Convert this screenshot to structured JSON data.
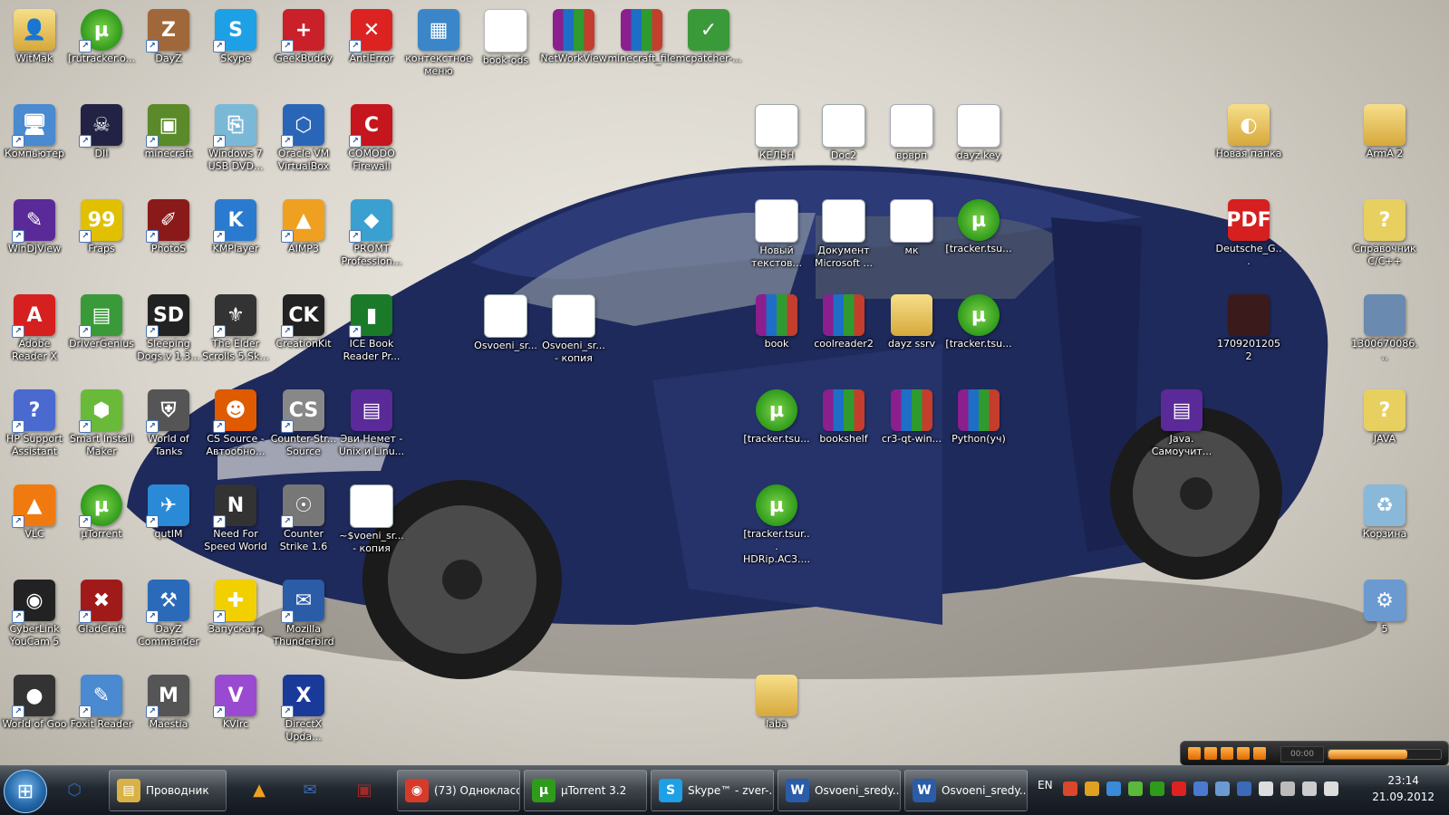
{
  "desktop": {
    "icons": [
      {
        "label": "WitMak",
        "icon": "folder-user-icon",
        "glyph": "👤",
        "color": "#d8b247"
      },
      {
        "label": "[rutracker.o...",
        "icon": "utorrent-icon",
        "glyph": "µ",
        "color": "#2f9b1b"
      },
      {
        "label": "DayZ",
        "icon": "dayz-icon",
        "glyph": "Z",
        "color": "#a0683a"
      },
      {
        "label": "Skype",
        "icon": "skype-icon",
        "glyph": "S",
        "color": "#1ea0e6"
      },
      {
        "label": "GeekBuddy",
        "icon": "geekbuddy-icon",
        "glyph": "+",
        "color": "#c9202a"
      },
      {
        "label": "AntiError",
        "icon": "antierror-shield-icon",
        "glyph": "✕",
        "color": "#d22"
      },
      {
        "label": "контекстное\nменю",
        "icon": "context-menu-icon",
        "glyph": "▦",
        "color": "#3a86c8"
      },
      {
        "label": "book-ods",
        "icon": "pdf-file-icon",
        "glyph": "",
        "color": "#ffffff"
      },
      {
        "label": "NetWorkView",
        "icon": "winrar-icon",
        "glyph": "",
        "color": "#8b1f8e"
      },
      {
        "label": "minecraft_file",
        "icon": "winrar-icon",
        "glyph": "",
        "color": "#8b1f8e"
      },
      {
        "label": "mcpatcher-...",
        "icon": "mcpatcher-icon",
        "glyph": "✓",
        "color": "#3a9a3a"
      },
      {
        "label": "Компьютер",
        "icon": "computer-icon",
        "glyph": "🖥",
        "color": "#4a8ad0"
      },
      {
        "label": "DII",
        "icon": "diablo-icon",
        "glyph": "☠",
        "color": "#222244"
      },
      {
        "label": "minecraft",
        "icon": "minecraft-icon",
        "glyph": "▣",
        "color": "#5a8a2a"
      },
      {
        "label": "Windows 7\nUSB DVD...",
        "icon": "usb-dvd-tool-icon",
        "glyph": "⎘",
        "color": "#7ab8d8"
      },
      {
        "label": "Oracle VM\nVirtualBox",
        "icon": "virtualbox-icon",
        "glyph": "⬡",
        "color": "#2a66b8"
      },
      {
        "label": "COMODO\nFirewall",
        "icon": "comodo-icon",
        "glyph": "C",
        "color": "#c4161c"
      },
      {
        "label": "WinDjView",
        "icon": "windjview-icon",
        "glyph": "✎",
        "color": "#5a2a98"
      },
      {
        "label": "Fraps",
        "icon": "fraps-icon",
        "glyph": "99",
        "color": "#e0c000"
      },
      {
        "label": "PhotoS",
        "icon": "photoshop-brush-icon",
        "glyph": "✐",
        "color": "#8a1a1a"
      },
      {
        "label": "KMPlayer",
        "icon": "kmplayer-icon",
        "glyph": "K",
        "color": "#2a7ad0"
      },
      {
        "label": "AIMP3",
        "icon": "aimp-icon",
        "glyph": "▲",
        "color": "#f0a020"
      },
      {
        "label": "PROMT\nProfession...",
        "icon": "promt-icon",
        "glyph": "◆",
        "color": "#3aa0d0"
      },
      {
        "label": "Adobe\nReader X",
        "icon": "adobe-reader-icon",
        "glyph": "A",
        "color": "#d61f1f"
      },
      {
        "label": "DriverGenius",
        "icon": "drivergenius-icon",
        "glyph": "▤",
        "color": "#3a9a3a"
      },
      {
        "label": "Sleeping\nDogs.v 1.3...",
        "icon": "sleeping-dogs-icon",
        "glyph": "SD",
        "color": "#222"
      },
      {
        "label": "The Elder\nScrolls 5.Sk...",
        "icon": "skyrim-icon",
        "glyph": "⚜",
        "color": "#333"
      },
      {
        "label": "CreationKit",
        "icon": "creationkit-icon",
        "glyph": "CK",
        "color": "#222"
      },
      {
        "label": "ICE Book\nReader Pr...",
        "icon": "ice-book-icon",
        "glyph": "▮",
        "color": "#1a7a2a"
      },
      {
        "label": "HP Support\nAssistant",
        "icon": "hp-support-icon",
        "glyph": "?",
        "color": "#4a6ad0"
      },
      {
        "label": "Smart Install\nMaker",
        "icon": "smart-install-icon",
        "glyph": "⬢",
        "color": "#6aba3a"
      },
      {
        "label": "World of\nTanks",
        "icon": "world-of-tanks-icon",
        "glyph": "⛨",
        "color": "#555"
      },
      {
        "label": "CS Source -\nАвтообно...",
        "icon": "cs-source-update-icon",
        "glyph": "☻",
        "color": "#e05a00"
      },
      {
        "label": "Counter-Str...\nSource",
        "icon": "counter-strike-source-icon",
        "glyph": "CS",
        "color": "#888"
      },
      {
        "label": "Эви Немет -\nUnix и Linu...",
        "icon": "djvu-file-icon",
        "glyph": "▤",
        "color": "#5a2a98"
      },
      {
        "label": "VLC",
        "icon": "vlc-icon",
        "glyph": "▲",
        "color": "#f07a10"
      },
      {
        "label": "µTorrent",
        "icon": "utorrent-icon",
        "glyph": "µ",
        "color": "#2f9b1b"
      },
      {
        "label": "qutIM",
        "icon": "qutim-icon",
        "glyph": "✈",
        "color": "#2a8ad8"
      },
      {
        "label": "Need For\nSpeed World",
        "icon": "nfs-world-icon",
        "glyph": "N",
        "color": "#333"
      },
      {
        "label": "Counter\nStrike 1.6",
        "icon": "counter-strike-icon",
        "glyph": "☉",
        "color": "#777"
      },
      {
        "label": "~$voeni_sr...\n- копия",
        "icon": "word-doc-icon",
        "glyph": "W",
        "color": "#2a5ca8"
      },
      {
        "label": "CyberLink\nYouCam 5",
        "icon": "youcam-icon",
        "glyph": "◉",
        "color": "#222"
      },
      {
        "label": "GladCraft",
        "icon": "gladcraft-icon",
        "glyph": "✖",
        "color": "#a01a1a"
      },
      {
        "label": "DayZ\nCommander",
        "icon": "dayz-commander-icon",
        "glyph": "⚒",
        "color": "#2a6ab8"
      },
      {
        "label": "Запускатр",
        "icon": "launcher-icon",
        "glyph": "✚",
        "color": "#f2d000"
      },
      {
        "label": "Mozilla\nThunderbird",
        "icon": "thunderbird-icon",
        "glyph": "✉",
        "color": "#2a5ca8"
      },
      {
        "label": "World of Goo",
        "icon": "world-of-goo-icon",
        "glyph": "●",
        "color": "#333"
      },
      {
        "label": "Foxit Reader",
        "icon": "foxit-reader-icon",
        "glyph": "✎",
        "color": "#4a8ad0"
      },
      {
        "label": "Maestia",
        "icon": "maestia-icon",
        "glyph": "M",
        "color": "#555"
      },
      {
        "label": "KVIrc",
        "icon": "kvirc-icon",
        "glyph": "V",
        "color": "#9a4ad0"
      },
      {
        "label": "DirectX\nUpda...",
        "icon": "directx-icon",
        "glyph": "X",
        "color": "#1a3a9a"
      },
      {
        "label": "КЕЛЬН",
        "icon": "word-doc-icon",
        "glyph": "W",
        "color": "#2a5ca8"
      },
      {
        "label": "Doc2",
        "icon": "word-doc-icon",
        "glyph": "W",
        "color": "#2a5ca8"
      },
      {
        "label": "врврп",
        "icon": "text-file-icon",
        "glyph": "",
        "color": "#fff"
      },
      {
        "label": "dayz.key",
        "icon": "text-file-icon",
        "glyph": "",
        "color": "#fff"
      },
      {
        "label": "Новый\nтекстов...",
        "icon": "text-file-icon",
        "glyph": "",
        "color": "#fff"
      },
      {
        "label": "Документ\nMicrosoft ...",
        "icon": "word-doc-icon",
        "glyph": "W",
        "color": "#2a5ca8"
      },
      {
        "label": "мк",
        "icon": "text-file-icon",
        "glyph": "",
        "color": "#fff"
      },
      {
        "label": "[tracker.tsu...",
        "icon": "utorrent-icon",
        "glyph": "µ",
        "color": "#2f9b1b"
      },
      {
        "label": "Osvoeni_sr...",
        "icon": "word-doc-icon",
        "glyph": "W",
        "color": "#2a5ca8"
      },
      {
        "label": "Osvoeni_sr...\n- копия",
        "icon": "word-doc-icon",
        "glyph": "W",
        "color": "#2a5ca8"
      },
      {
        "label": "book",
        "icon": "winrar-icon",
        "glyph": "",
        "color": "#8b1f8e"
      },
      {
        "label": "coolreader2",
        "icon": "winrar-icon",
        "glyph": "",
        "color": "#8b1f8e"
      },
      {
        "label": "dayz ssrv",
        "icon": "folder-icon",
        "glyph": "",
        "color": "#d8b247"
      },
      {
        "label": "[tracker.tsu...",
        "icon": "utorrent-icon",
        "glyph": "µ",
        "color": "#2f9b1b"
      },
      {
        "label": "[tracker.tsu...",
        "icon": "utorrent-icon",
        "glyph": "µ",
        "color": "#2f9b1b"
      },
      {
        "label": "bookshelf",
        "icon": "winrar-icon",
        "glyph": "",
        "color": "#8b1f8e"
      },
      {
        "label": "cr3-qt-win...",
        "icon": "winrar-icon",
        "glyph": "",
        "color": "#8b1f8e"
      },
      {
        "label": "Python(уч)",
        "icon": "winrar-icon",
        "glyph": "",
        "color": "#8b1f8e"
      },
      {
        "label": "[tracker.tsur...\nHDRip.AC3....",
        "icon": "utorrent-icon",
        "glyph": "µ",
        "color": "#2f9b1b"
      },
      {
        "label": "laba",
        "icon": "folder-icon",
        "glyph": "",
        "color": "#d8b247"
      },
      {
        "label": "Новая папка",
        "icon": "folder-icon",
        "glyph": "◐",
        "color": "#d8b247"
      },
      {
        "label": "Deutsche_G...",
        "icon": "pdf-file-icon",
        "glyph": "PDF",
        "color": "#d61f1f"
      },
      {
        "label": "17092012052",
        "icon": "image-file-icon",
        "glyph": "",
        "color": "#3a1a1a"
      },
      {
        "label": "Java.\nСамоучит...",
        "icon": "djvu-file-icon",
        "glyph": "▤",
        "color": "#5a2a98"
      },
      {
        "label": "ArmA 2",
        "icon": "folder-icon",
        "glyph": "",
        "color": "#d8b247"
      },
      {
        "label": "Справочник\nС/С++",
        "icon": "help-file-icon",
        "glyph": "?",
        "color": "#e8d060"
      },
      {
        "label": "1300670086...",
        "icon": "image-file-icon",
        "glyph": "",
        "color": "#6a8ab0"
      },
      {
        "label": "JAVA",
        "icon": "help-file-icon",
        "glyph": "?",
        "color": "#e8d060"
      },
      {
        "label": "Корзина",
        "icon": "recycle-bin-icon",
        "glyph": "♻",
        "color": "#8ab8d8"
      },
      {
        "label": "5",
        "icon": "settings-file-icon",
        "glyph": "⚙",
        "color": "#6a9ad0"
      }
    ]
  },
  "player": {
    "time": "00:00"
  },
  "taskbar": {
    "start_glyph": "⊞",
    "pinned": [
      {
        "name": "virtualbox-pin-icon",
        "glyph": "⬡",
        "color": "#2a66b8"
      },
      {
        "name": "aimp-pin-icon",
        "glyph": "▲",
        "color": "#f0a020"
      },
      {
        "name": "thunderbird-pin-icon",
        "glyph": "✉",
        "color": "#3a6ab8"
      },
      {
        "name": "save-disk-pin-icon",
        "glyph": "▣",
        "color": "#a02a2a"
      }
    ],
    "explorer_label": "Проводник",
    "windows": [
      {
        "label": "(73) Однокласс...",
        "icon": "chrome-icon",
        "glyph": "◉",
        "color": "#d83a2a"
      },
      {
        "label": "µTorrent 3.2",
        "icon": "utorrent-icon",
        "glyph": "µ",
        "color": "#2f9b1b"
      },
      {
        "label": "Skype™ - zver-...",
        "icon": "skype-icon",
        "glyph": "S",
        "color": "#1ea0e6"
      },
      {
        "label": "Osvoeni_sredy...",
        "icon": "word-doc-icon",
        "glyph": "W",
        "color": "#2a5ca8"
      },
      {
        "label": "Osvoeni_sredy...",
        "icon": "word-doc-icon",
        "glyph": "W",
        "color": "#2a5ca8"
      }
    ],
    "language": "EN",
    "clock_time": "23:14",
    "clock_date": "21.09.2012"
  }
}
